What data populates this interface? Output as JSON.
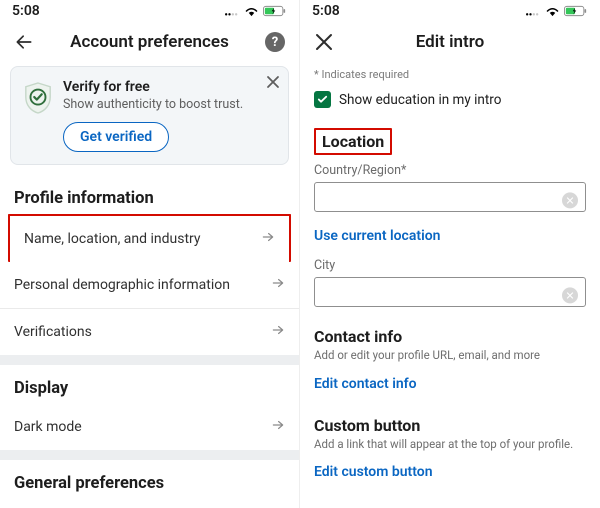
{
  "status": {
    "time": "5:08"
  },
  "left": {
    "title": "Account preferences",
    "verify": {
      "title": "Verify for free",
      "subtitle": "Show authenticity to boost trust.",
      "button": "Get verified"
    },
    "sections": {
      "profile": {
        "heading": "Profile information",
        "rows": {
          "name_loc_industry": "Name, location, and industry",
          "demographic": "Personal demographic information",
          "verifications": "Verifications"
        }
      },
      "display": {
        "heading": "Display",
        "rows": {
          "dark_mode": "Dark mode"
        }
      },
      "general": {
        "heading": "General preferences"
      }
    }
  },
  "right": {
    "title": "Edit intro",
    "required_note": "* Indicates required",
    "show_education_label": "Show education in my intro",
    "location": {
      "heading": "Location",
      "country_label": "Country/Region*",
      "country_value": "",
      "use_current": "Use current location",
      "city_label": "City",
      "city_value": ""
    },
    "contact": {
      "heading": "Contact info",
      "desc": "Add or edit your profile URL, email, and more",
      "link": "Edit contact info"
    },
    "custom_button": {
      "heading": "Custom button",
      "desc": "Add a link that will appear at the top of your profile.",
      "link": "Edit custom button"
    }
  }
}
